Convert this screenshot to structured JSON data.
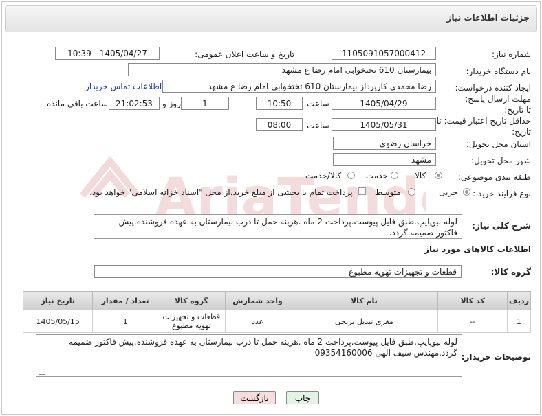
{
  "header": {
    "title": "جزئیات اطلاعات نیاز"
  },
  "form": {
    "need_number": {
      "label": "شماره نیاز:",
      "value": "1105091057000412"
    },
    "announce_datetime": {
      "label": "تاریخ و ساعت اعلان عمومی:",
      "value": "1405/04/27 - 10:39"
    },
    "buyer_org": {
      "label": "نام دستگاه خریدار:",
      "value": "بیمارستان 610 تختخوابی امام رضا ع  مشهد"
    },
    "requester": {
      "label": "ایجاد کننده درخواست:",
      "value": "رضا محمدی کارپرداز بیمارستان 610 تختخوابی امام رضا ع  مشهد",
      "contact_link": "اطلاعات تماس خریدار"
    },
    "reply_deadline": {
      "label": "مهلت ارسال پاسخ: تا تاریخ:",
      "date": "1405/04/29",
      "time_label": "ساعت",
      "time": "10:50",
      "days": "1",
      "days_label": "روز و",
      "remaining": "21:02:53",
      "remaining_label": "ساعت باقی مانده"
    },
    "price_validity": {
      "label": "حداقل تاریخ اعتبار قیمت: تا تاریخ:",
      "date": "1405/05/31",
      "time_label": "ساعت",
      "time": "08:00"
    },
    "delivery_province": {
      "label": "استان محل تحویل:",
      "value": "خراسان رضوی"
    },
    "delivery_city": {
      "label": "شهر محل تحویل:",
      "value": "مشهد"
    },
    "category": {
      "label": "طبقه بندی موضوعی:",
      "options": [
        "کالا",
        "خدمت",
        "کالا/خدمت"
      ],
      "selected": "کالا"
    },
    "process_type": {
      "label": "نوع فرآیند خرید :",
      "options": [
        "جزیی",
        "متوسط"
      ],
      "selected": "جزیی",
      "treasury_note": "پرداخت تمام یا بخشی از مبلغ خرید،از محل \"اسناد خزانه اسلامی\" خواهد بود."
    }
  },
  "description": {
    "label": "شرح کلی نیاز:",
    "value": "لوله نیوپایپ.طبق فایل پیوست.پرداخت 2 ماه .هزینه حمل تا درب بیمارستان به عهده فروشنده.پیش فاکتور ضمیمه گردد."
  },
  "goods_info": {
    "heading": "اطلاعات کالاهای مورد نیاز",
    "group_label": "گروه کالا:",
    "group_value": "قطعات و تجهیزات تهویه مطبوع"
  },
  "table": {
    "columns": [
      "ردیف",
      "کد کالا",
      "نام کالا",
      "واحد شمارش",
      "گروه کالا",
      "تعداد / مقدار",
      "تاریخ نیاز"
    ],
    "rows": [
      [
        "1",
        "--",
        "مغزی تبدیل برنجی",
        "عدد",
        "قطعات و تجهیزات تهویه مطبوع",
        "1",
        "1405/05/15"
      ]
    ]
  },
  "buyer_notes": {
    "label": "توضیحات خریدار:",
    "value": "لوله نیوپایپ.طبق فایل پیوست.پرداخت 2 ماه .هزینه حمل تا درب بیمارستان به عهده فروشنده.پیش فاکتور ضمیمه گردد.مهندس سیف الهی 09354160006"
  },
  "actions": {
    "print": "چاپ",
    "back": "بازگشت"
  },
  "watermark": {
    "text": "AriaTender.net"
  },
  "colors": {
    "link": "#1a3fae",
    "back_button": "#f7dede",
    "print_button": "#e4f4e4",
    "watermark": "#f3d9d9"
  }
}
